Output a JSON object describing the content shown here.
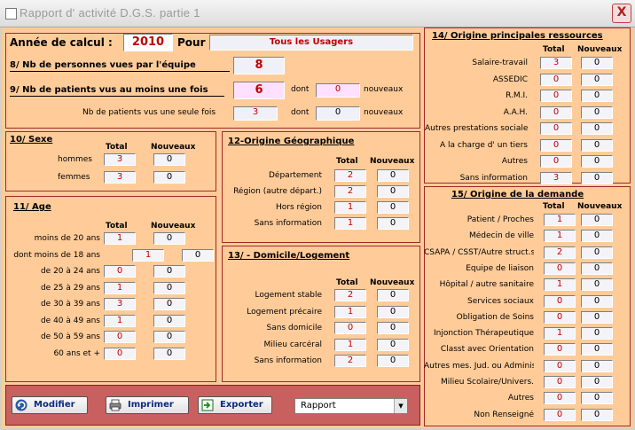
{
  "window": {
    "title": "Rapport d' activité  D.G.S. partie 1",
    "close_label": "X"
  },
  "header": {
    "year_label": "Année de calcul :",
    "year_value": "2010",
    "pour_label": "Pour",
    "pour_value": "Tous les Usagers",
    "q8_label": "8/  Nb de personnes vues par l'équipe",
    "q8_value": "8",
    "q9_label": "9/ Nb de patients vus au moins une fois",
    "q9_value": "6",
    "dont_label": "dont",
    "q9_new": "0",
    "nouveaux_label": "nouveaux",
    "once_label": "Nb de patients vus une seule fois",
    "once_value": "3",
    "once_new": "0"
  },
  "headers": {
    "total": "Total",
    "nouveaux": "Nouveaux"
  },
  "sexe": {
    "title": "10/ Sexe",
    "rows": [
      {
        "label": "hommes",
        "total": "3",
        "new": "0"
      },
      {
        "label": "femmes",
        "total": "3",
        "new": "0"
      }
    ]
  },
  "age": {
    "title": "11/ Age",
    "rows": [
      {
        "label": "moins de 20 ans",
        "total": "1",
        "new": "0"
      },
      {
        "label": "dont moins de 18 ans",
        "total": "1",
        "new": "0"
      },
      {
        "label": "de 20 à 24 ans",
        "total": "0",
        "new": "0"
      },
      {
        "label": "de 25 à 29 ans",
        "total": "1",
        "new": "0"
      },
      {
        "label": "de 30 à 39 ans",
        "total": "3",
        "new": "0"
      },
      {
        "label": "de 40 à 49 ans",
        "total": "1",
        "new": "0"
      },
      {
        "label": "de 50 à 59 ans",
        "total": "0",
        "new": "0"
      },
      {
        "label": "60 ans et +",
        "total": "0",
        "new": "0"
      }
    ]
  },
  "geo": {
    "title": "12-Origine Géographique",
    "rows": [
      {
        "label": "Département",
        "total": "2",
        "new": "0"
      },
      {
        "label": "Région (autre départ.)",
        "total": "2",
        "new": "0"
      },
      {
        "label": "Hors région",
        "total": "1",
        "new": "0"
      },
      {
        "label": "Sans information",
        "total": "1",
        "new": "0"
      }
    ]
  },
  "domicile": {
    "title": "13/ - Domicile/Logement",
    "rows": [
      {
        "label": "Logement stable",
        "total": "2",
        "new": "0"
      },
      {
        "label": "Logement précaire",
        "total": "1",
        "new": "0"
      },
      {
        "label": "Sans domicile",
        "total": "0",
        "new": "0"
      },
      {
        "label": "Milieu carcéral",
        "total": "1",
        "new": "0"
      },
      {
        "label": "Sans information",
        "total": "2",
        "new": "0"
      }
    ]
  },
  "ressources": {
    "title": "14/ Origine principales ressources",
    "rows": [
      {
        "label": "Salaire-travail",
        "total": "3",
        "new": "0"
      },
      {
        "label": "ASSEDIC",
        "total": "0",
        "new": "0"
      },
      {
        "label": "R.M.I.",
        "total": "0",
        "new": "0"
      },
      {
        "label": "A.A.H.",
        "total": "0",
        "new": "0"
      },
      {
        "label": "Autres prestations sociales",
        "total": "0",
        "new": "0"
      },
      {
        "label": "A la charge d' un tiers",
        "total": "0",
        "new": "0"
      },
      {
        "label": "Autres",
        "total": "0",
        "new": "0"
      },
      {
        "label": "Sans information",
        "total": "3",
        "new": "0"
      }
    ]
  },
  "demande": {
    "title": "15/ Origine de la demande",
    "rows": [
      {
        "label": "Patient / Proches",
        "total": "1",
        "new": "0"
      },
      {
        "label": "Médecin de ville",
        "total": "1",
        "new": "0"
      },
      {
        "label": "CSAPA / CSST/Autre struct.spé.",
        "total": "2",
        "new": "0"
      },
      {
        "label": "Equipe de liaison",
        "total": "0",
        "new": "0"
      },
      {
        "label": "Hôpital / autre sanitaire",
        "total": "1",
        "new": "0"
      },
      {
        "label": "Services sociaux",
        "total": "0",
        "new": "0"
      },
      {
        "label": "Obligation de Soins",
        "total": "0",
        "new": "0"
      },
      {
        "label": "Injonction Thérapeutique",
        "total": "1",
        "new": "0"
      },
      {
        "label": "Classt avec Orientation",
        "total": "0",
        "new": "0"
      },
      {
        "label": "Autres mes. Jud. ou Administr.",
        "total": "0",
        "new": "0"
      },
      {
        "label": "Milieu Scolaire/Univers.",
        "total": "0",
        "new": "0"
      },
      {
        "label": "Autres",
        "total": "0",
        "new": "0"
      },
      {
        "label": "Non Renseigné",
        "total": "0",
        "new": "0"
      }
    ]
  },
  "toolbar": {
    "modifier": "Modifier",
    "imprimer": "Imprimer",
    "exporter": "Exporter",
    "report_select": "Rapport"
  }
}
